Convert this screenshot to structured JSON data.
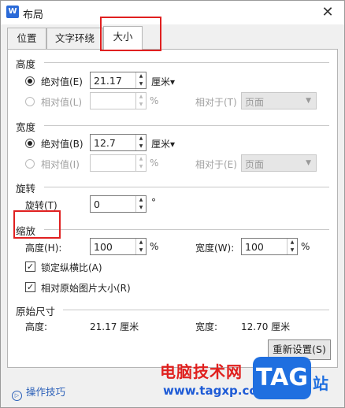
{
  "window": {
    "title": "布局",
    "logo_letter": "W",
    "close_glyph": "✕"
  },
  "tabs": [
    {
      "label": "位置"
    },
    {
      "label": "文字环绕"
    },
    {
      "label": "大小",
      "active": true
    }
  ],
  "height": {
    "title": "高度",
    "absolute_label": "绝对值(E)",
    "absolute_value": "21.17",
    "unit": "厘米▾",
    "relative_label": "相对值(L)",
    "relative_unit": "%",
    "relative_to_label": "相对于(T)",
    "relative_to_value": "页面"
  },
  "width": {
    "title": "宽度",
    "absolute_label": "绝对值(B)",
    "absolute_value": "12.7",
    "unit": "厘米▾",
    "relative_label": "相对值(I)",
    "relative_unit": "%",
    "relative_to_label": "相对于(E)",
    "relative_to_value": "页面"
  },
  "rotate": {
    "title": "旋转",
    "label": "旋转(T)",
    "value": "0",
    "unit": "°"
  },
  "scale": {
    "title": "缩放",
    "height_label": "高度(H):",
    "height_value": "100",
    "height_unit": "%",
    "width_label": "宽度(W):",
    "width_value": "100",
    "width_unit": "%",
    "lock_label": "锁定纵横比(A)",
    "lock_checked": true,
    "relative_original_label": "相对原始图片大小(R)",
    "relative_original_checked": true,
    "check_glyph": "✓"
  },
  "original": {
    "title": "原始尺寸",
    "height_label": "高度:",
    "height_value": "21.17 厘米",
    "width_label": "宽度:",
    "width_value": "12.70 厘米"
  },
  "reset_button": "重新设置(S)",
  "footer": {
    "tips_link": "操作技巧",
    "tips_icon": "▷"
  },
  "watermark": {
    "text": "电脑技术网",
    "url": "www.tagxp.com",
    "tag": "TAG",
    "zhan": "站"
  },
  "colors": {
    "highlight_red": "#e02020",
    "link_blue": "#2a5fb8"
  }
}
